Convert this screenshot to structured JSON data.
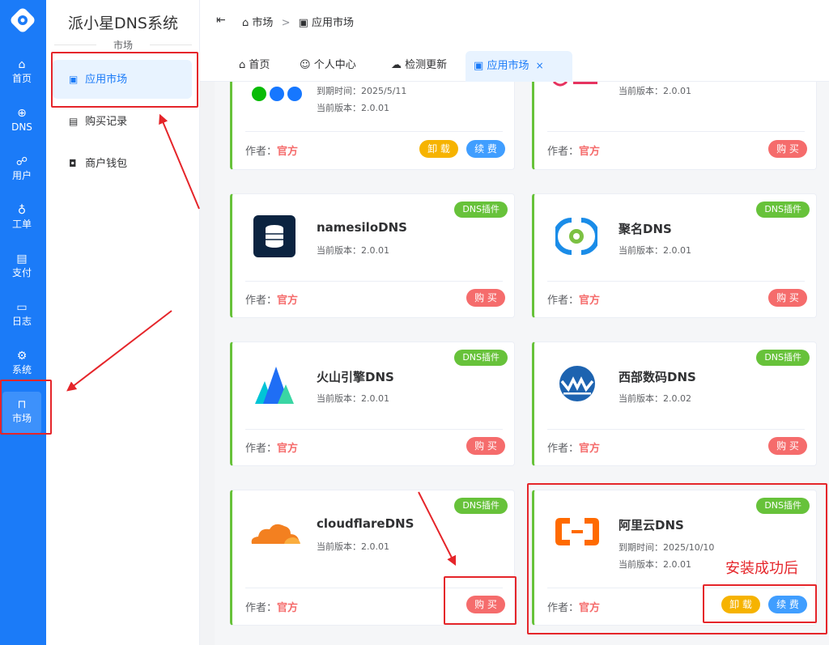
{
  "rail": {
    "items": [
      {
        "label": "首页",
        "icon": "home-icon"
      },
      {
        "label": "DNS",
        "icon": "globe-icon"
      },
      {
        "label": "用户",
        "icon": "users-icon"
      },
      {
        "label": "工单",
        "icon": "headset-icon"
      },
      {
        "label": "支付",
        "icon": "card-icon"
      },
      {
        "label": "日志",
        "icon": "book-icon"
      },
      {
        "label": "系统",
        "icon": "gear-icon"
      },
      {
        "label": "市场",
        "icon": "bag-icon"
      }
    ]
  },
  "sidebar": {
    "title": "派小星DNS系统",
    "group": "市场",
    "items": [
      {
        "label": "应用市场",
        "icon": "store-icon"
      },
      {
        "label": "购买记录",
        "icon": "receipt-icon"
      },
      {
        "label": "商户钱包",
        "icon": "wallet-icon"
      }
    ]
  },
  "breadcrumb": {
    "first": "市场",
    "separator": ">",
    "second": "应用市场"
  },
  "tabs": [
    {
      "label": "首页",
      "icon": "home-icon"
    },
    {
      "label": "个人中心",
      "icon": "user-icon"
    },
    {
      "label": "检测更新",
      "icon": "cloud-icon"
    },
    {
      "label": "应用市场",
      "icon": "store-icon",
      "close": "×"
    }
  ],
  "cards": [
    {
      "name": "",
      "expire": "到期时间：2025/5/11",
      "version": "当前版本：2.0.01",
      "author_label": "作者：",
      "author": "官方",
      "btn1": "卸 载",
      "btn2": "续 费"
    },
    {
      "name": "",
      "version": "当前版本：2.0.01",
      "author_label": "作者：",
      "author": "官方",
      "btn1": "购 买"
    },
    {
      "name": "namesiloDNS",
      "tag": "DNS插件",
      "version": "当前版本：2.0.01",
      "author_label": "作者：",
      "author": "官方",
      "btn1": "购 买"
    },
    {
      "name": "聚名DNS",
      "tag": "DNS插件",
      "version": "当前版本：2.0.01",
      "author_label": "作者：",
      "author": "官方",
      "btn1": "购 买"
    },
    {
      "name": "火山引擎DNS",
      "tag": "DNS插件",
      "version": "当前版本：2.0.01",
      "author_label": "作者：",
      "author": "官方",
      "btn1": "购 买"
    },
    {
      "name": "西部数码DNS",
      "tag": "DNS插件",
      "version": "当前版本：2.0.02",
      "author_label": "作者：",
      "author": "官方",
      "btn1": "购 买"
    },
    {
      "name": "cloudflareDNS",
      "tag": "DNS插件",
      "version": "当前版本：2.0.01",
      "author_label": "作者：",
      "author": "官方",
      "btn1": "购 买"
    },
    {
      "name": "阿里云DNS",
      "tag": "DNS插件",
      "expire": "到期时间：2025/10/10",
      "version": "当前版本：2.0.01",
      "author_label": "作者：",
      "author": "官方",
      "btn1": "卸 载",
      "btn2": "续 费"
    }
  ],
  "annotation": {
    "text": "安装成功后"
  },
  "colors": {
    "primary": "#1b7bf8",
    "success": "#67c23a",
    "danger": "#f56c6c",
    "warning": "#f6b300",
    "annotation": "#e5252a"
  }
}
